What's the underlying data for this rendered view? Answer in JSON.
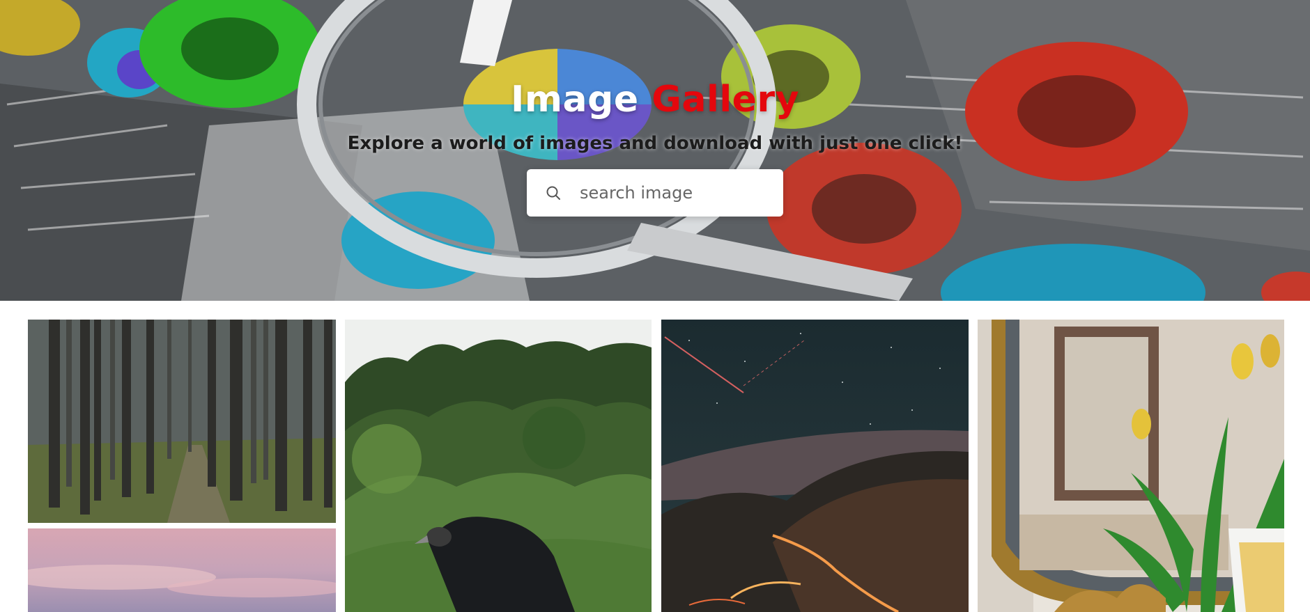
{
  "hero": {
    "title_white": "Image",
    "title_red": "Gallery",
    "subtitle": "Explore a world of images and download with just one click!",
    "title_accent_color": "#e4070d"
  },
  "search": {
    "placeholder": "search image",
    "value": "",
    "icon": "search-icon"
  },
  "gallery": {
    "images": [
      {
        "name": "forest"
      },
      {
        "name": "pink-sky"
      },
      {
        "name": "vulture"
      },
      {
        "name": "night-road"
      },
      {
        "name": "tulips-mirror"
      }
    ]
  }
}
